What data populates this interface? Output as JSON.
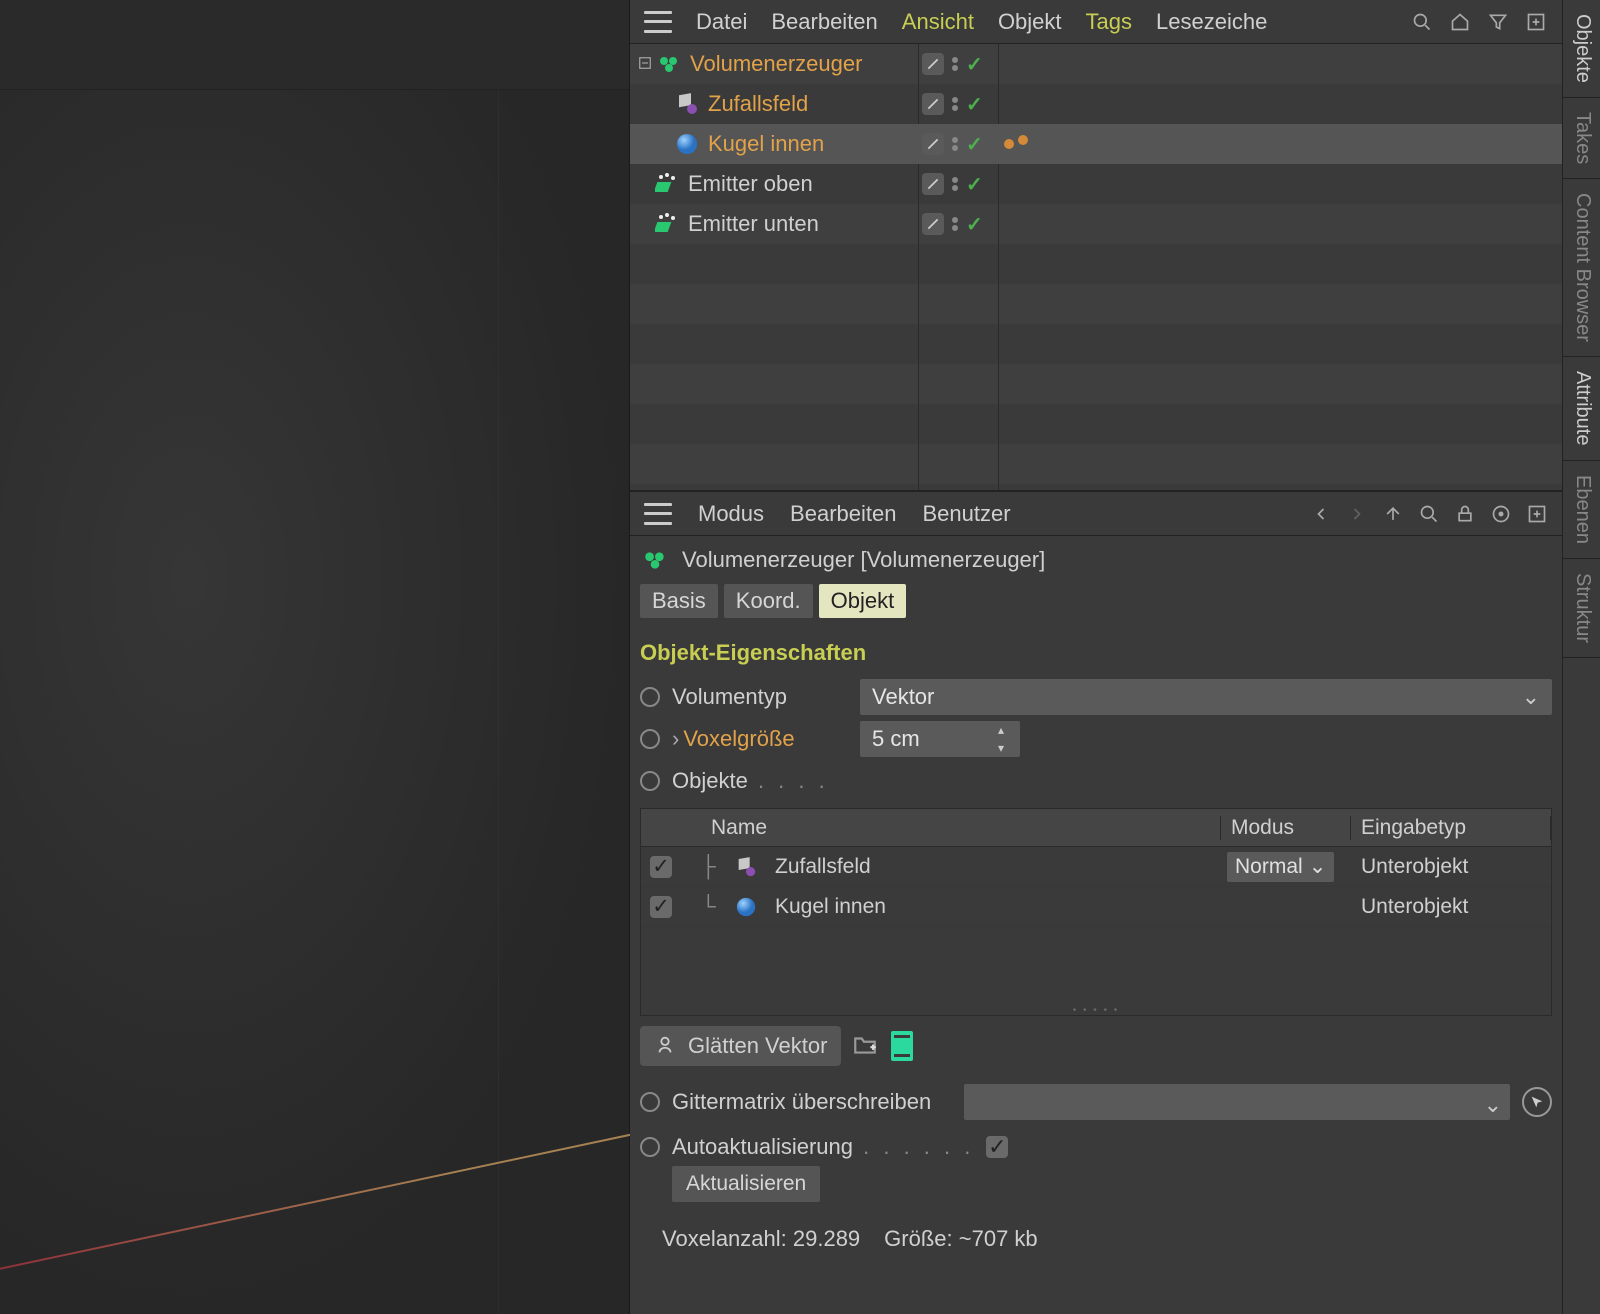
{
  "viewport": {},
  "object_manager": {
    "menu": {
      "datei": "Datei",
      "bearbeiten": "Bearbeiten",
      "ansicht": "Ansicht",
      "objekt": "Objekt",
      "tags": "Tags",
      "lesezeiche": "Lesezeiche"
    },
    "tree": [
      {
        "label": "Volumenerzeuger",
        "icon": "volume-builder",
        "orange": true,
        "depth": 0,
        "selected": false,
        "extra": false
      },
      {
        "label": "Zufallsfeld",
        "icon": "random-field",
        "orange": true,
        "depth": 1,
        "selected": false,
        "extra": false
      },
      {
        "label": "Kugel innen",
        "icon": "sphere",
        "orange": true,
        "depth": 1,
        "selected": true,
        "extra": true
      },
      {
        "label": "Emitter oben",
        "icon": "emitter",
        "orange": false,
        "depth": 0,
        "selected": false,
        "extra": false
      },
      {
        "label": "Emitter unten",
        "icon": "emitter",
        "orange": false,
        "depth": 0,
        "selected": false,
        "extra": false
      }
    ]
  },
  "attribute_manager": {
    "menu": {
      "modus": "Modus",
      "bearbeiten": "Bearbeiten",
      "benutzer": "Benutzer"
    },
    "title": "Volumenerzeuger [Volumenerzeuger]",
    "tabs": {
      "basis": "Basis",
      "koord": "Koord.",
      "objekt": "Objekt"
    },
    "section_title": "Objekt-Eigenschaften",
    "volumentyp_label": "Volumentyp",
    "volumentyp_value": "Vektor",
    "voxel_label": "Voxelgröße",
    "voxel_value": "5 cm",
    "objekte_label": "Objekte",
    "table": {
      "head_name": "Name",
      "head_mode": "Modus",
      "head_type": "Eingabetyp",
      "rows": [
        {
          "name": "Zufallsfeld",
          "icon": "random-field",
          "mode": "Normal",
          "type": "Unterobjekt"
        },
        {
          "name": "Kugel innen",
          "icon": "sphere",
          "mode": "",
          "type": "Unterobjekt"
        }
      ]
    },
    "filter_label": "Glätten Vektor",
    "matrix_label": "Gittermatrix überschreiben",
    "auto_label": "Autoaktualisierung",
    "update_btn": "Aktualisieren",
    "info_voxel": "Voxelanzahl: 29.289",
    "info_size": "Größe: ~707 kb"
  },
  "side_tabs": {
    "objekte": "Objekte",
    "takes": "Takes",
    "content": "Content Browser",
    "attribute": "Attribute",
    "ebenen": "Ebenen",
    "struktur": "Struktur"
  }
}
